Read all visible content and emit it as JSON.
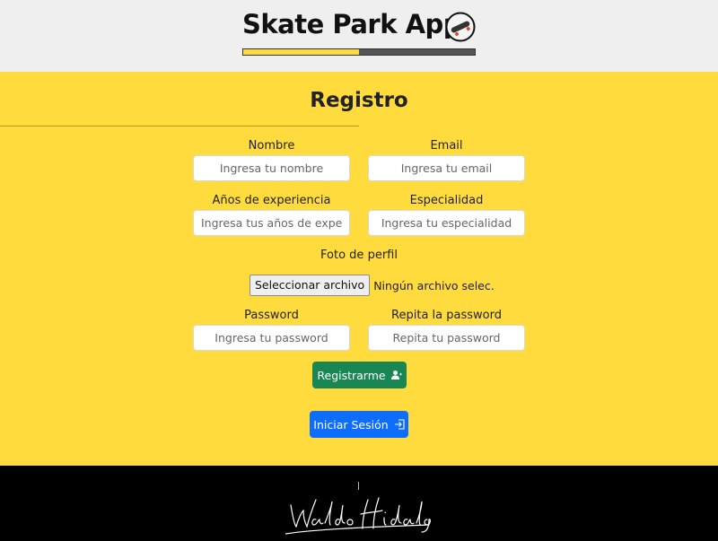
{
  "header": {
    "app_title": "Skate Park App",
    "logo": "skateboard-icon"
  },
  "form": {
    "title": "Registro",
    "nombre": {
      "label": "Nombre",
      "placeholder": "Ingresa tu nombre"
    },
    "email": {
      "label": "Email",
      "placeholder": "Ingresa tu email"
    },
    "experiencia": {
      "label": "Años de experiencia",
      "placeholder": "Ingresa tus años de experiencia"
    },
    "especialidad": {
      "label": "Especialidad",
      "placeholder": "Ingresa tu especialidad"
    },
    "foto": {
      "label": "Foto de perfil",
      "button": "Seleccionar archivo",
      "status": "Ningún archivo selec."
    },
    "password": {
      "label": "Password",
      "placeholder": "Ingresa tu password"
    },
    "repeat_password": {
      "label": "Repita la password",
      "placeholder": "Repita tu password"
    },
    "register_button": "Registrarme",
    "login_button": "Iniciar Sesión"
  },
  "footer": {
    "signature": "Waldo Hidalgo"
  },
  "colors": {
    "background": "#ffdb3e",
    "header": "#efefef",
    "register": "#198754",
    "login": "#0d6efd",
    "footer": "#000000"
  }
}
